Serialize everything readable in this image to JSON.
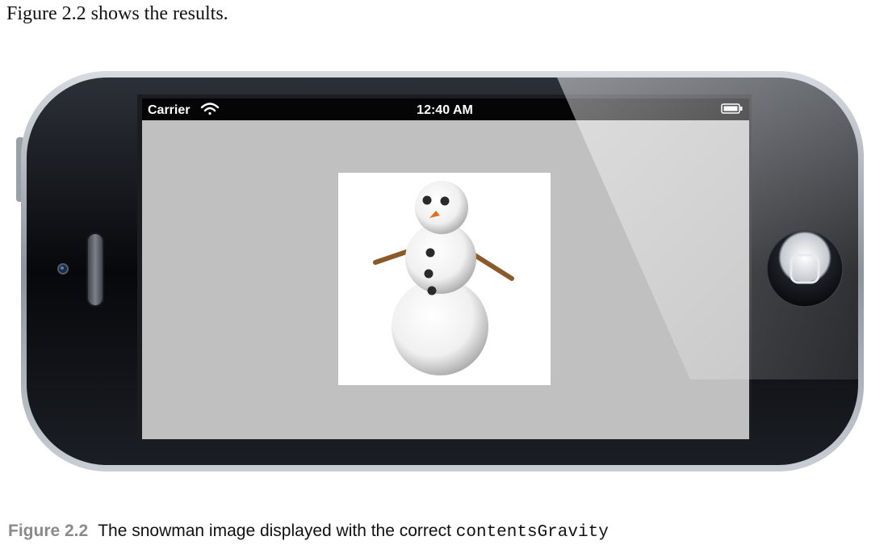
{
  "document": {
    "intro_text": "Figure 2.2 shows the results.",
    "caption": {
      "label": "Figure 2.2",
      "text": "The snowman image displayed with the correct",
      "code": "contentsGravity"
    }
  },
  "device": {
    "status_bar": {
      "carrier": "Carrier",
      "time": "12:40 AM",
      "wifi_icon": "wifi-icon",
      "battery_icon": "battery-icon"
    },
    "screen_background": "#c0c0c0",
    "content_image": "snowman-image",
    "home_button_icon": "home-button-icon"
  }
}
